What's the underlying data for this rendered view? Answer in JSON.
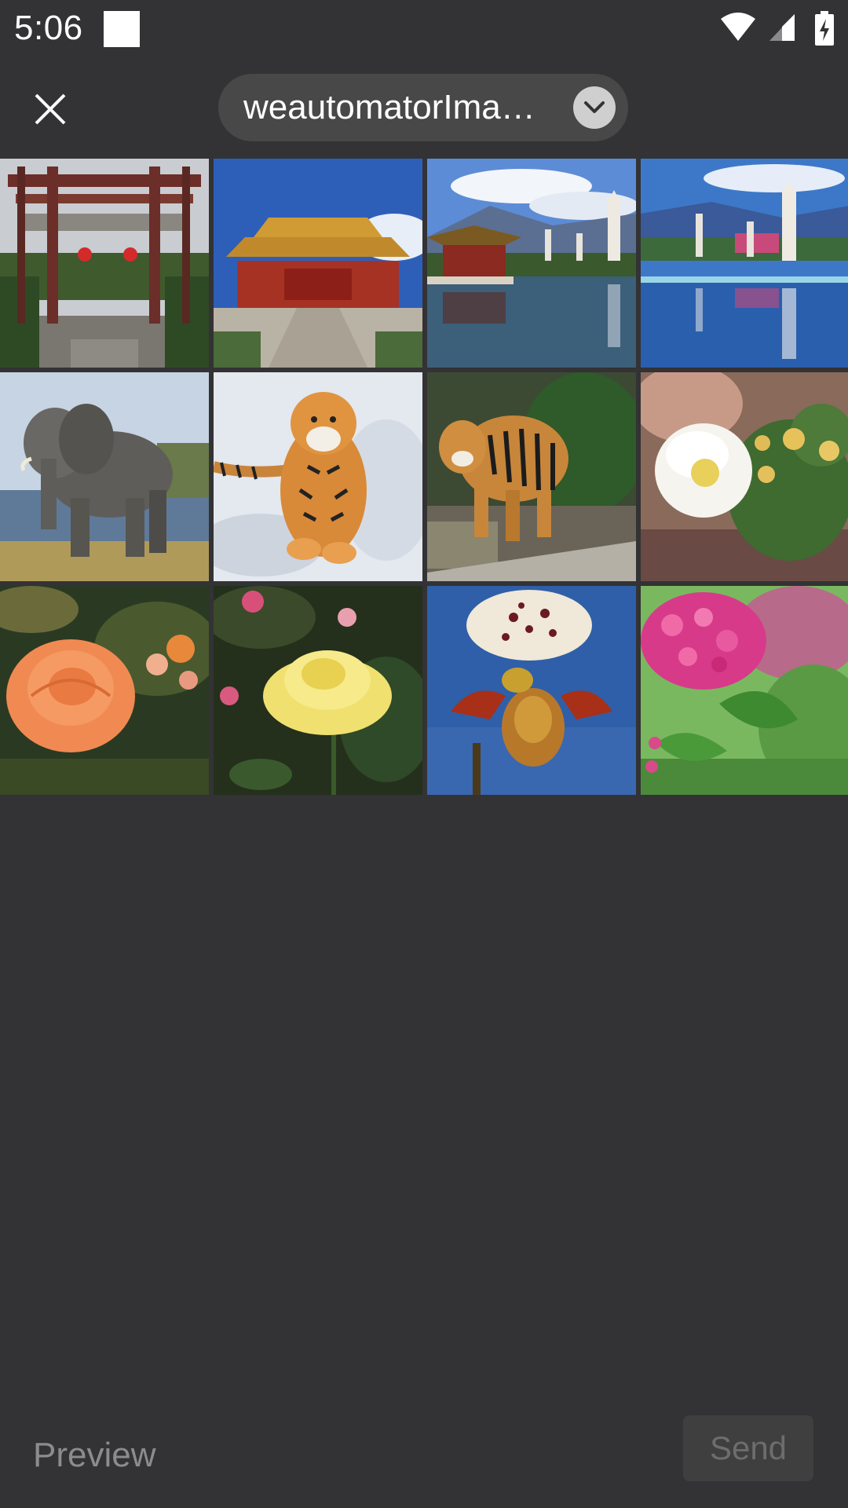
{
  "status_bar": {
    "time": "5:06",
    "icons": [
      "notification-square-icon",
      "wifi-icon",
      "cellular-signal-icon",
      "battery-charging-icon"
    ]
  },
  "header": {
    "close_icon": "close-icon",
    "album_name": "weautomatorIma…",
    "dropdown_icon": "chevron-down-icon"
  },
  "photos": [
    {
      "subject": "temple-gate"
    },
    {
      "subject": "palace-gate"
    },
    {
      "subject": "pagodas-pavilion-lake"
    },
    {
      "subject": "pagodas-reflection-lake"
    },
    {
      "subject": "elephant"
    },
    {
      "subject": "tiger-in-snow"
    },
    {
      "subject": "tiger-walking"
    },
    {
      "subject": "white-rose"
    },
    {
      "subject": "orange-rose"
    },
    {
      "subject": "yellow-rose"
    },
    {
      "subject": "orchid"
    },
    {
      "subject": "pink-flowers"
    }
  ],
  "bottom_bar": {
    "preview_label": "Preview",
    "send_label": "Send"
  },
  "colors": {
    "background": "#333234",
    "pill": "#484849",
    "send_bg": "#3f3f40",
    "send_text": "#6d6d6d",
    "preview_text": "#8c8c8c"
  }
}
